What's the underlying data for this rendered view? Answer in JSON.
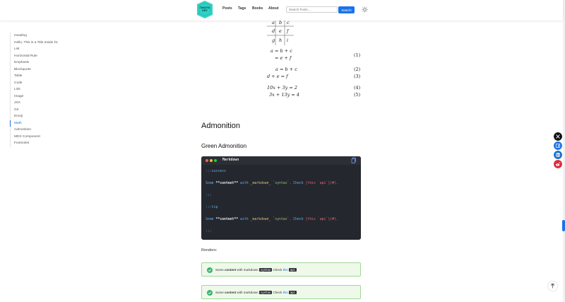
{
  "header": {
    "logo_text": "TAKUYA DEV",
    "nav": [
      "Posts",
      "Tags",
      "Books",
      "About"
    ],
    "search_placeholder": "Search Posts ...",
    "search_label": "Search",
    "theme_icon": "sun-icon"
  },
  "toc": {
    "items": [
      "Heading",
      "Hello, This is a Title inside h1",
      "List",
      "Horizontal Rule",
      "Emphasis",
      "Blockquote",
      "Table",
      "Code",
      "Link",
      "Image",
      "JSX",
      "Git",
      "Emoji",
      "Math",
      "Admonition",
      "MDX Component",
      "Footnotes"
    ],
    "active": "Math"
  },
  "math": {
    "matrix": [
      "a",
      "b",
      "c",
      "d",
      "e",
      "f",
      "g",
      "h",
      "i"
    ],
    "align1_line1": "a = b + c",
    "align1_line2": "= e + f",
    "align1_num": "(1)",
    "eq2": "a = b + c",
    "eq2_num": "(2)",
    "eq3": "d + e = f",
    "eq3_num": "(3)",
    "eq4": "10x +  3y = 2",
    "eq4_num": "(4)",
    "eq5": "3x + 13y = 4",
    "eq5_num": "(5)"
  },
  "admonition_heading": "Admonition",
  "green_heading": "Green Admonition",
  "code": {
    "title": "Markdown",
    "copy_icon": "copy-icon",
    "line1": ":::success",
    "line3_part1": "Some ",
    "line3_part2": "**content**",
    "line3_part3": " with ",
    "line3_part4": "_markdown_",
    "line3_part5": " ",
    "line3_part6": "`syntax`",
    "line3_part7": ". Check ",
    "line3_part8": "[this `api`](#)",
    "line3_part9": ".",
    "line5": ":::",
    "line7": ":::tip",
    "line11": ":::"
  },
  "renders_label": "Renders:",
  "admonition": {
    "text1": "Some",
    "bold": "content",
    "text2": "with markdown",
    "kbd": "syntax",
    "text3": "Check",
    "link": "this",
    "kbd2": "api"
  },
  "colors": {
    "accent": "#1a73e8",
    "admonition_bg": "#eef9ea",
    "admonition_border": "#9fd894",
    "code_bg": "#24272d"
  },
  "share_icons": [
    "x-icon",
    "facebook-icon",
    "linkedin-icon",
    "weibo-icon"
  ]
}
